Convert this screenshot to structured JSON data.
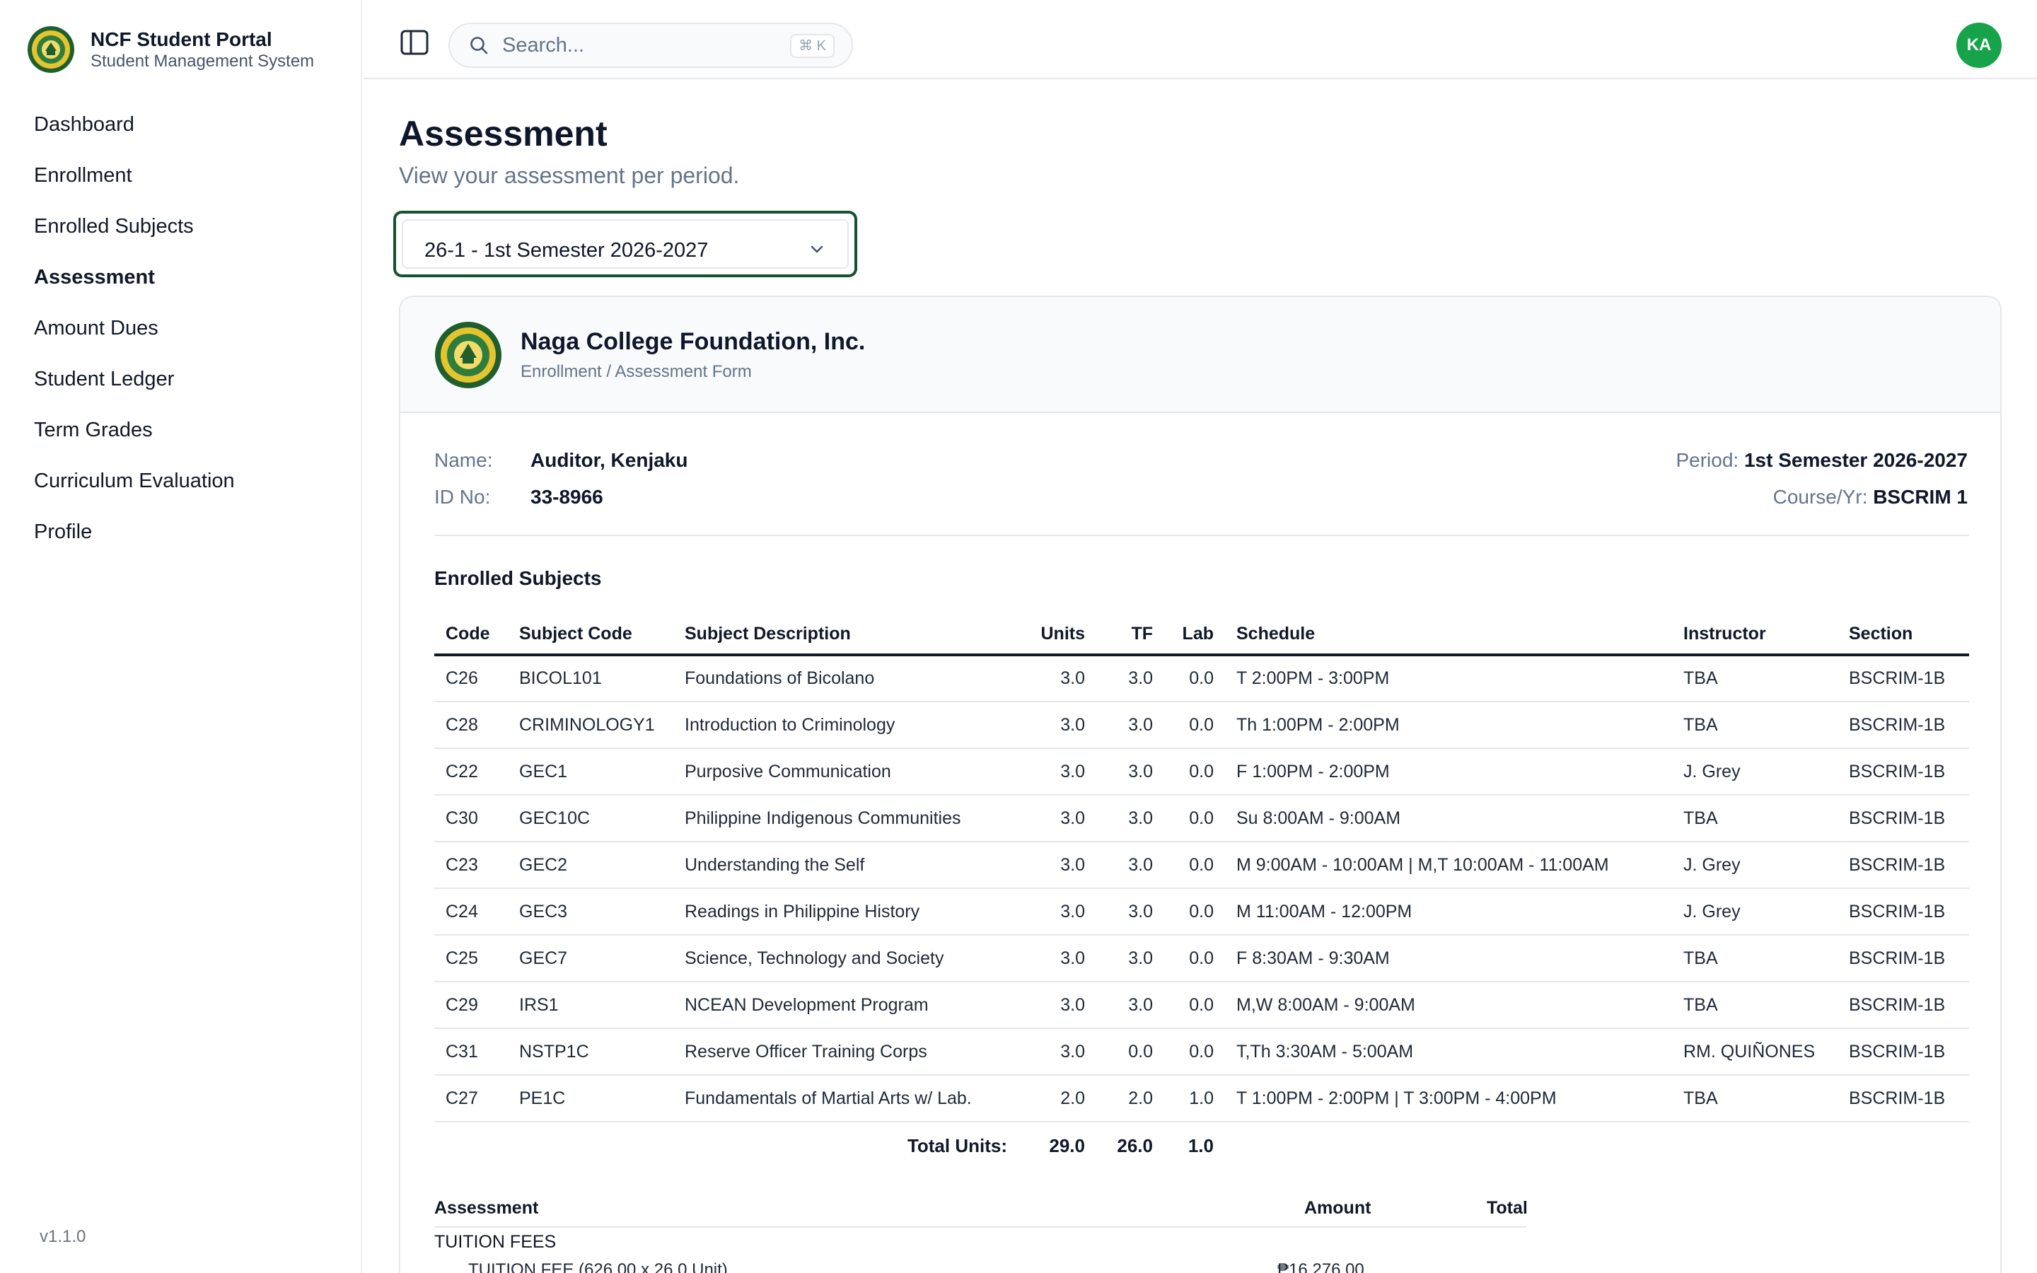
{
  "sidebar": {
    "title": "NCF Student Portal",
    "subtitle": "Student Management System",
    "items": [
      {
        "label": "Dashboard"
      },
      {
        "label": "Enrollment"
      },
      {
        "label": "Enrolled Subjects"
      },
      {
        "label": "Assessment"
      },
      {
        "label": "Amount Dues"
      },
      {
        "label": "Student Ledger"
      },
      {
        "label": "Term Grades"
      },
      {
        "label": "Curriculum Evaluation"
      },
      {
        "label": "Profile"
      }
    ],
    "active": "Assessment",
    "version": "v1.1.0"
  },
  "topbar": {
    "search_placeholder": "Search...",
    "search_value": "",
    "shortcut": "⌘ K",
    "avatar_initials": "KA"
  },
  "page": {
    "title": "Assessment",
    "subtitle": "View your assessment per period.",
    "period_selected": "26-1 - 1st Semester 2026-2027"
  },
  "form": {
    "school_name": "Naga College Foundation, Inc.",
    "form_name": "Enrollment / Assessment Form",
    "name_label": "Name:",
    "name_value": "Auditor, Kenjaku",
    "id_label": "ID No:",
    "id_value": "33-8966",
    "period_label": "Period:",
    "period_value": "1st Semester 2026-2027",
    "course_label": "Course/Yr:",
    "course_value": "BSCRIM 1",
    "subjects_title": "Enrolled Subjects"
  },
  "table": {
    "headers": {
      "code": "Code",
      "subject_code": "Subject Code",
      "description": "Subject Description",
      "units": "Units",
      "tf": "TF",
      "lab": "Lab",
      "schedule": "Schedule",
      "instructor": "Instructor",
      "section": "Section"
    },
    "rows": [
      {
        "code": "C26",
        "subject_code": "BICOL101",
        "description": "Foundations of Bicolano",
        "units": "3.0",
        "tf": "3.0",
        "lab": "0.0",
        "schedule": "T 2:00PM - 3:00PM",
        "instructor": "TBA",
        "section": "BSCRIM-1B"
      },
      {
        "code": "C28",
        "subject_code": "CRIMINOLOGY1",
        "description": "Introduction to Criminology",
        "units": "3.0",
        "tf": "3.0",
        "lab": "0.0",
        "schedule": "Th 1:00PM - 2:00PM",
        "instructor": "TBA",
        "section": "BSCRIM-1B"
      },
      {
        "code": "C22",
        "subject_code": "GEC1",
        "description": "Purposive Communication",
        "units": "3.0",
        "tf": "3.0",
        "lab": "0.0",
        "schedule": "F 1:00PM - 2:00PM",
        "instructor": "J. Grey",
        "section": "BSCRIM-1B"
      },
      {
        "code": "C30",
        "subject_code": "GEC10C",
        "description": "Philippine Indigenous Communities",
        "units": "3.0",
        "tf": "3.0",
        "lab": "0.0",
        "schedule": "Su 8:00AM - 9:00AM",
        "instructor": "TBA",
        "section": "BSCRIM-1B"
      },
      {
        "code": "C23",
        "subject_code": "GEC2",
        "description": "Understanding the Self",
        "units": "3.0",
        "tf": "3.0",
        "lab": "0.0",
        "schedule": "M 9:00AM - 10:00AM | M,T 10:00AM - 11:00AM",
        "instructor": "J. Grey",
        "section": "BSCRIM-1B"
      },
      {
        "code": "C24",
        "subject_code": "GEC3",
        "description": "Readings in Philippine History",
        "units": "3.0",
        "tf": "3.0",
        "lab": "0.0",
        "schedule": "M 11:00AM - 12:00PM",
        "instructor": "J. Grey",
        "section": "BSCRIM-1B"
      },
      {
        "code": "C25",
        "subject_code": "GEC7",
        "description": "Science, Technology and Society",
        "units": "3.0",
        "tf": "3.0",
        "lab": "0.0",
        "schedule": "F 8:30AM - 9:30AM",
        "instructor": "TBA",
        "section": "BSCRIM-1B"
      },
      {
        "code": "C29",
        "subject_code": "IRS1",
        "description": "NCEAN Development Program",
        "units": "3.0",
        "tf": "3.0",
        "lab": "0.0",
        "schedule": "M,W 8:00AM - 9:00AM",
        "instructor": "TBA",
        "section": "BSCRIM-1B"
      },
      {
        "code": "C31",
        "subject_code": "NSTP1C",
        "description": "Reserve Officer Training Corps",
        "units": "3.0",
        "tf": "0.0",
        "lab": "0.0",
        "schedule": "T,Th 3:30AM - 5:00AM",
        "instructor": "RM. QUIÑONES",
        "section": "BSCRIM-1B"
      },
      {
        "code": "C27",
        "subject_code": "PE1C",
        "description": "Fundamentals of Martial Arts w/ Lab.",
        "units": "2.0",
        "tf": "2.0",
        "lab": "1.0",
        "schedule": "T 1:00PM - 2:00PM | T 3:00PM - 4:00PM",
        "instructor": "TBA",
        "section": "BSCRIM-1B"
      }
    ],
    "total_label": "Total Units:",
    "total_units": "29.0",
    "total_tf": "26.0",
    "total_lab": "1.0"
  },
  "assessment": {
    "header_assessment": "Assessment",
    "header_amount": "Amount",
    "header_total": "Total",
    "tuition_label": "TUITION FEES",
    "tuition_fee_label": "TUITION FEE (626.00 x 26.0 Unit)",
    "tuition_fee_amount": "₱16,276.00"
  },
  "colors": {
    "accent_green": "#14532d",
    "avatar_green": "#16a34a",
    "muted_text": "#64748b"
  }
}
